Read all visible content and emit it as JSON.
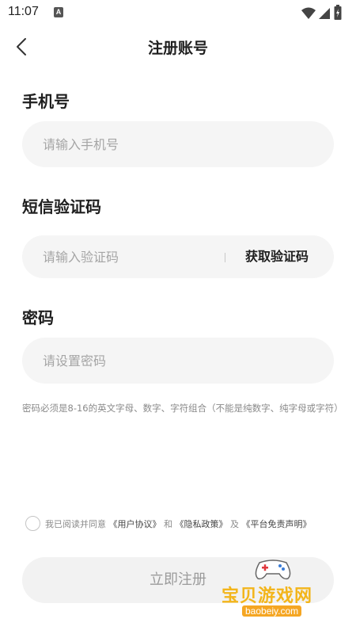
{
  "status_bar": {
    "time": "11:07",
    "notification_badge": "A"
  },
  "header": {
    "title": "注册账号",
    "back_icon": "chevron-left-icon"
  },
  "phone": {
    "label": "手机号",
    "placeholder": "请输入手机号",
    "value": ""
  },
  "sms_code": {
    "label": "短信验证码",
    "placeholder": "请输入验证码",
    "value": "",
    "get_code_label": "获取验证码"
  },
  "password": {
    "label": "密码",
    "placeholder": "请设置密码",
    "value": "",
    "hint": "密码必须是8-16的英文字母、数字、字符组合（不能是纯数字、纯字母或字符）"
  },
  "agreement": {
    "checked": false,
    "prefix": "我已阅读并同意",
    "user_agreement": "《用户协议》",
    "and_1": "和",
    "privacy_policy": "《隐私政策》",
    "and_2": "及",
    "platform_disclaimer": "《平台免责声明》"
  },
  "register_button": {
    "label": "立即注册"
  },
  "watermark": {
    "name": "宝贝游戏网",
    "url": "baobeiy.com"
  },
  "colors": {
    "field_bg": "#f5f5f5",
    "button_bg": "#f2f2f2",
    "watermark": "#f3b51b"
  }
}
